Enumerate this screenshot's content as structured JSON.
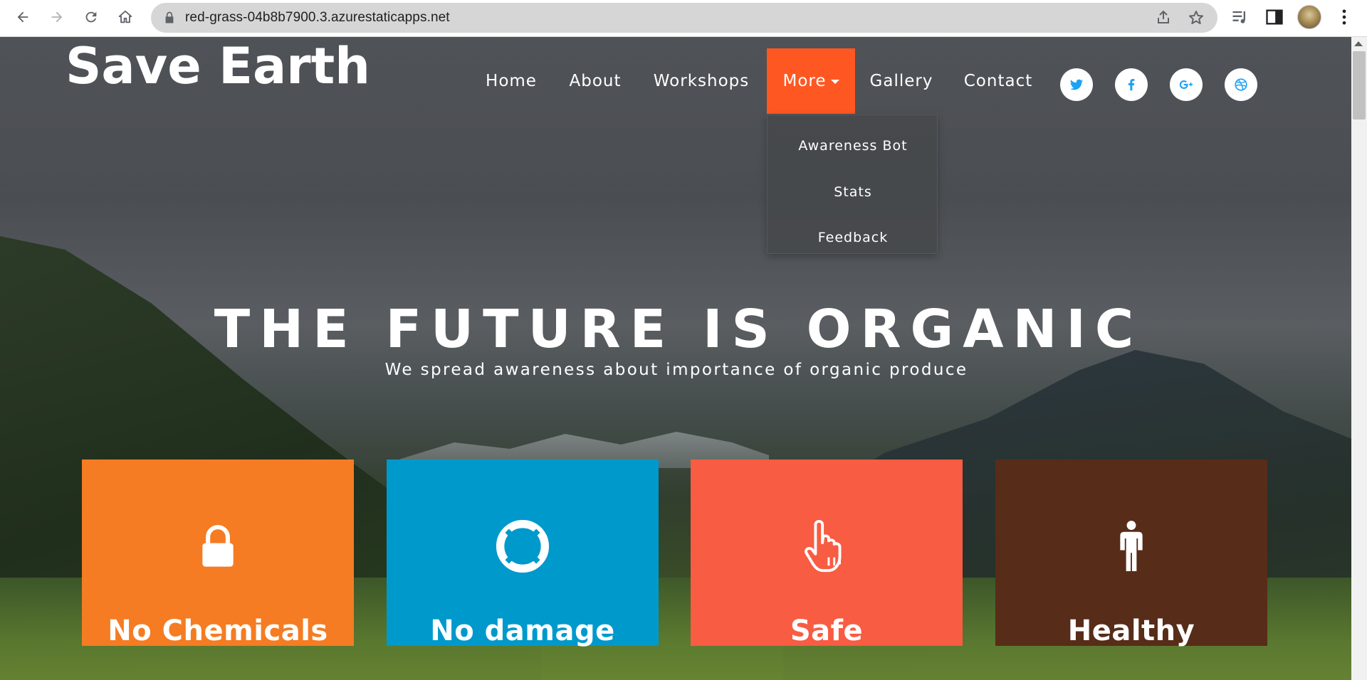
{
  "browser": {
    "url": "red-grass-04b8b7900.3.azurestaticapps.net",
    "back_icon": "back-arrow-icon",
    "forward_icon": "forward-arrow-icon",
    "reload_icon": "reload-icon",
    "home_icon": "home-icon"
  },
  "site": {
    "brand": "Save Earth",
    "nav": {
      "home": "Home",
      "about": "About",
      "workshops": "Workshops",
      "more": "More",
      "gallery": "Gallery",
      "contact": "Contact"
    },
    "dropdown": {
      "item1": "Awareness Bot",
      "item2": "Stats",
      "item3": "Feedback"
    },
    "social": [
      "twitter-icon",
      "facebook-icon",
      "google-plus-icon",
      "dribbble-icon"
    ],
    "accent_color": "#ff5722",
    "social_icon_color": "#1da1f2"
  },
  "hero": {
    "title": "THE FUTURE IS ORGANIC",
    "subtitle": "We spread awareness about importance of organic produce"
  },
  "features": [
    {
      "label": "No Chemicals",
      "icon": "lock-icon",
      "color": "#f57c22"
    },
    {
      "label": "No damage",
      "icon": "lifebuoy-icon",
      "color": "#0099cc"
    },
    {
      "label": "Safe",
      "icon": "pointing-hand-icon",
      "color": "#f85c42"
    },
    {
      "label": "Healthy",
      "icon": "person-icon",
      "color": "#572c18"
    }
  ]
}
